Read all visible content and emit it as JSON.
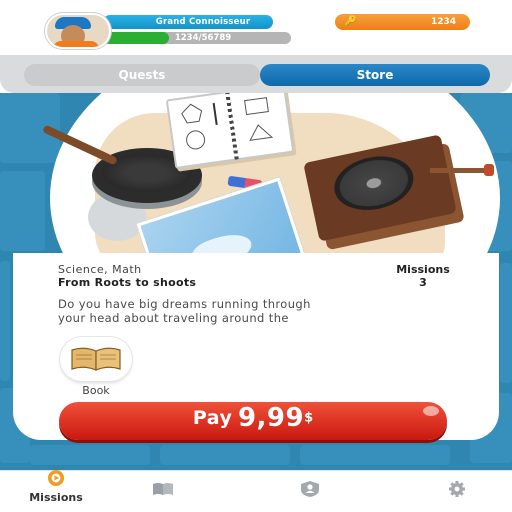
{
  "header": {
    "player_name": "Grand Connoisseur",
    "xp_text": "1234/56789",
    "xp_fraction": 0.35,
    "coins": "1234",
    "coin_icon": "key-icon",
    "avatar_icon": "avatar-boy-cap"
  },
  "tabs": [
    {
      "label": "Quests",
      "active": false
    },
    {
      "label": "Store",
      "active": true
    }
  ],
  "product": {
    "subject": "Science, Math",
    "title": "From Roots to shoots",
    "missions_label": "Missions",
    "missions_count": "3",
    "description_line1": "Do you have big dreams running through",
    "description_line2": "your head about traveling around the",
    "format_label": "Book",
    "format_icon": "book-icon"
  },
  "purchase": {
    "label": "Pay",
    "amount": "9,99",
    "currency": "$"
  },
  "bottom_nav": {
    "missions_label": "Missions",
    "items": [
      "missions-icon",
      "book-icon",
      "profile-badge-icon",
      "gear-icon"
    ]
  },
  "colors": {
    "tab_active": "#1b7bbd",
    "pay_button": "#e23a26",
    "coins_pill": "#f2881e",
    "name_pill": "#1fa6dd",
    "xp_fill": "#2cae34",
    "background": "#2f86b0",
    "nav_active": "#f29a1e"
  }
}
